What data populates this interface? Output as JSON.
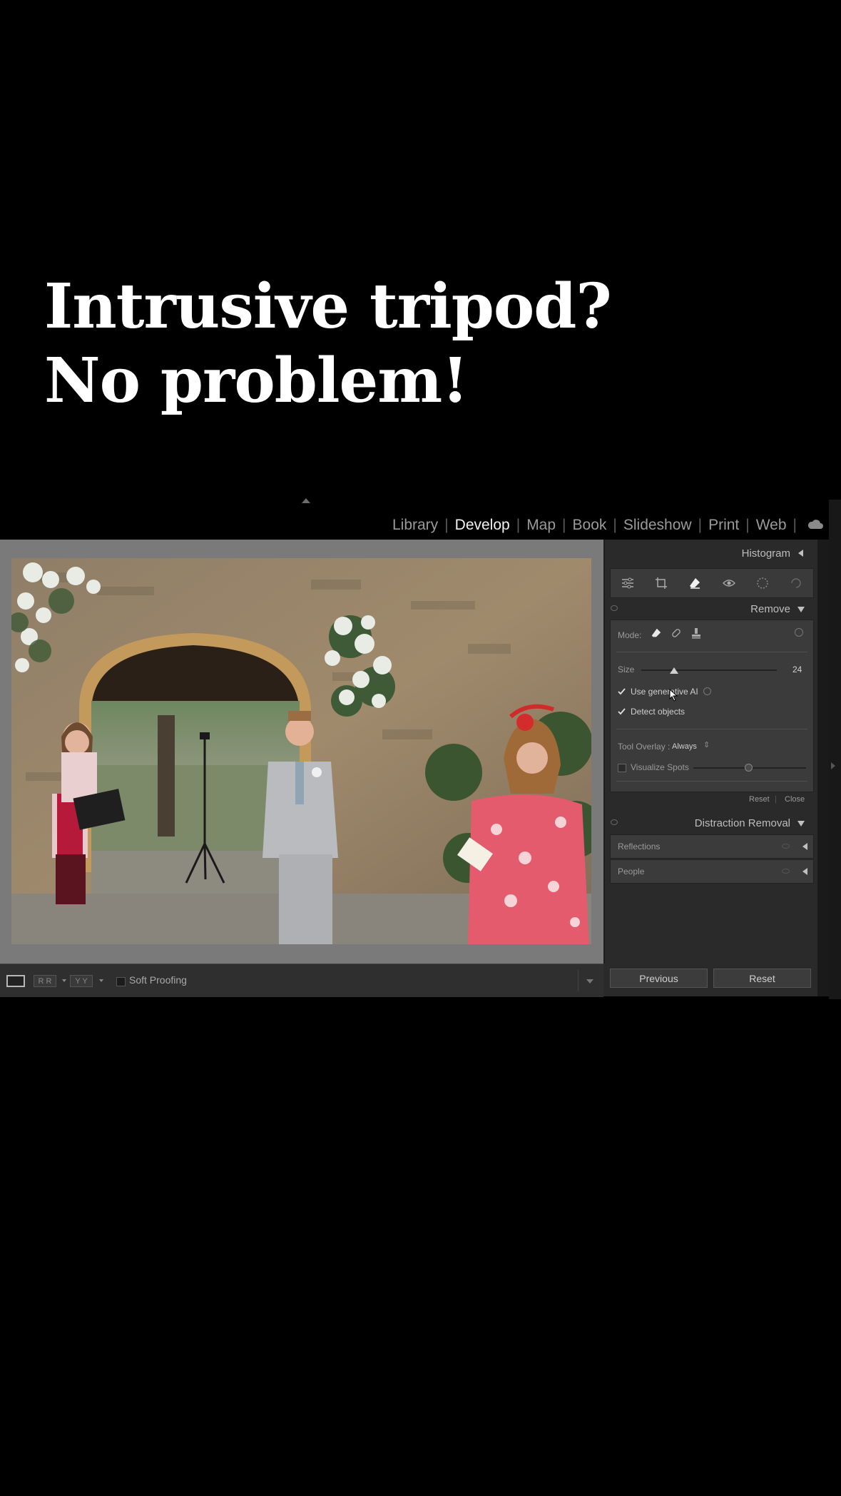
{
  "headline": {
    "line1": "Intrusive tripod?",
    "line2": "No problem!"
  },
  "modules": [
    "Library",
    "Develop",
    "Map",
    "Book",
    "Slideshow",
    "Print",
    "Web"
  ],
  "active_module": "Develop",
  "toolbar": {
    "soft_proofing_label": "Soft Proofing",
    "btn_rr": "R R",
    "btn_yy": "Y Y"
  },
  "right_panel": {
    "histogram_label": "Histogram",
    "remove_label": "Remove",
    "mode_label": "Mode:",
    "size_label": "Size",
    "size_value": "24",
    "size_fraction": 0.24,
    "use_gen_ai_label": "Use generative AI",
    "use_gen_ai_checked": true,
    "detect_objects_label": "Detect objects",
    "detect_objects_checked": true,
    "tool_overlay_label": "Tool Overlay :",
    "tool_overlay_value": "Always",
    "visualize_spots_label": "Visualize Spots",
    "visualize_spots_checked": false,
    "visualize_fraction": 0.5,
    "reset_label": "Reset",
    "close_label": "Close",
    "distraction_label": "Distraction Removal",
    "reflections_label": "Reflections",
    "people_label": "People",
    "previous_button": "Previous",
    "reset_button": "Reset"
  },
  "colors": {
    "background": "#000000",
    "panel": "#2a2a2a",
    "photo_frame": "#7a7a7a"
  }
}
